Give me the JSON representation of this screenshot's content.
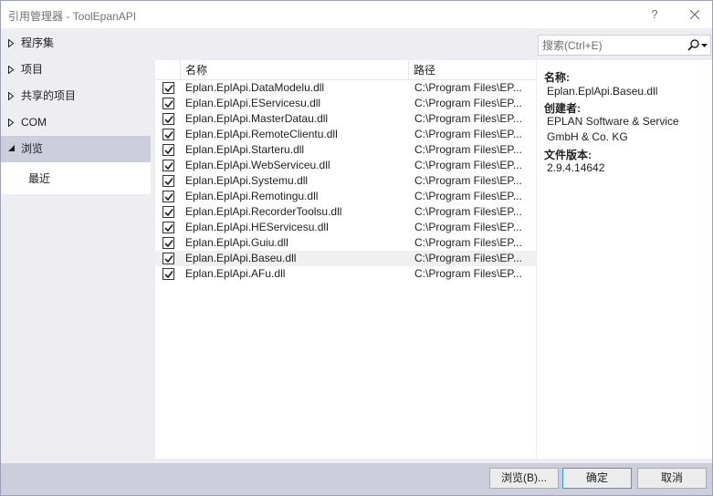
{
  "window": {
    "title": "引用管理器 - ToolEpanAPI",
    "help_label": "?",
    "close_icon": "close-icon"
  },
  "nav": {
    "items": [
      {
        "label": "程序集",
        "expanded": false
      },
      {
        "label": "项目",
        "expanded": false
      },
      {
        "label": "共享的项目",
        "expanded": false
      },
      {
        "label": "COM",
        "expanded": false
      },
      {
        "label": "浏览",
        "expanded": true,
        "selected": true
      }
    ],
    "sub_items": [
      {
        "label": "最近"
      }
    ]
  },
  "list": {
    "columns": {
      "name": "名称",
      "path": "路径"
    },
    "rows": [
      {
        "checked": true,
        "name": "Eplan.EplApi.DataModelu.dll",
        "path": "C:\\Program Files\\EP..."
      },
      {
        "checked": true,
        "name": "Eplan.EplApi.EServicesu.dll",
        "path": "C:\\Program Files\\EP..."
      },
      {
        "checked": true,
        "name": "Eplan.EplApi.MasterDatau.dll",
        "path": "C:\\Program Files\\EP..."
      },
      {
        "checked": true,
        "name": "Eplan.EplApi.RemoteClientu.dll",
        "path": "C:\\Program Files\\EP..."
      },
      {
        "checked": true,
        "name": "Eplan.EplApi.Starteru.dll",
        "path": "C:\\Program Files\\EP..."
      },
      {
        "checked": true,
        "name": "Eplan.EplApi.WebServiceu.dll",
        "path": "C:\\Program Files\\EP..."
      },
      {
        "checked": true,
        "name": "Eplan.EplApi.Systemu.dll",
        "path": "C:\\Program Files\\EP..."
      },
      {
        "checked": true,
        "name": "Eplan.EplApi.Remotingu.dll",
        "path": "C:\\Program Files\\EP..."
      },
      {
        "checked": true,
        "name": "Eplan.EplApi.RecorderToolsu.dll",
        "path": "C:\\Program Files\\EP..."
      },
      {
        "checked": true,
        "name": "Eplan.EplApi.HEServicesu.dll",
        "path": "C:\\Program Files\\EP..."
      },
      {
        "checked": true,
        "name": "Eplan.EplApi.Guiu.dll",
        "path": "C:\\Program Files\\EP..."
      },
      {
        "checked": true,
        "name": "Eplan.EplApi.Baseu.dll",
        "path": "C:\\Program Files\\EP...",
        "highlighted": true
      },
      {
        "checked": true,
        "name": "Eplan.EplApi.AFu.dll",
        "path": "C:\\Program Files\\EP..."
      }
    ]
  },
  "search": {
    "placeholder": "搜索(Ctrl+E)",
    "value": "",
    "icon": "search-icon"
  },
  "details": {
    "name_label": "名称:",
    "name_value": "Eplan.EplApi.Baseu.dll",
    "creator_label": "创建者:",
    "creator_value_line1": "EPLAN Software & Service",
    "creator_value_line2": "GmbH & Co. KG",
    "version_label": "文件版本:",
    "version_value": "2.9.4.14642"
  },
  "footer": {
    "browse_label": "浏览(B)...",
    "ok_label": "确定",
    "cancel_label": "取消"
  }
}
